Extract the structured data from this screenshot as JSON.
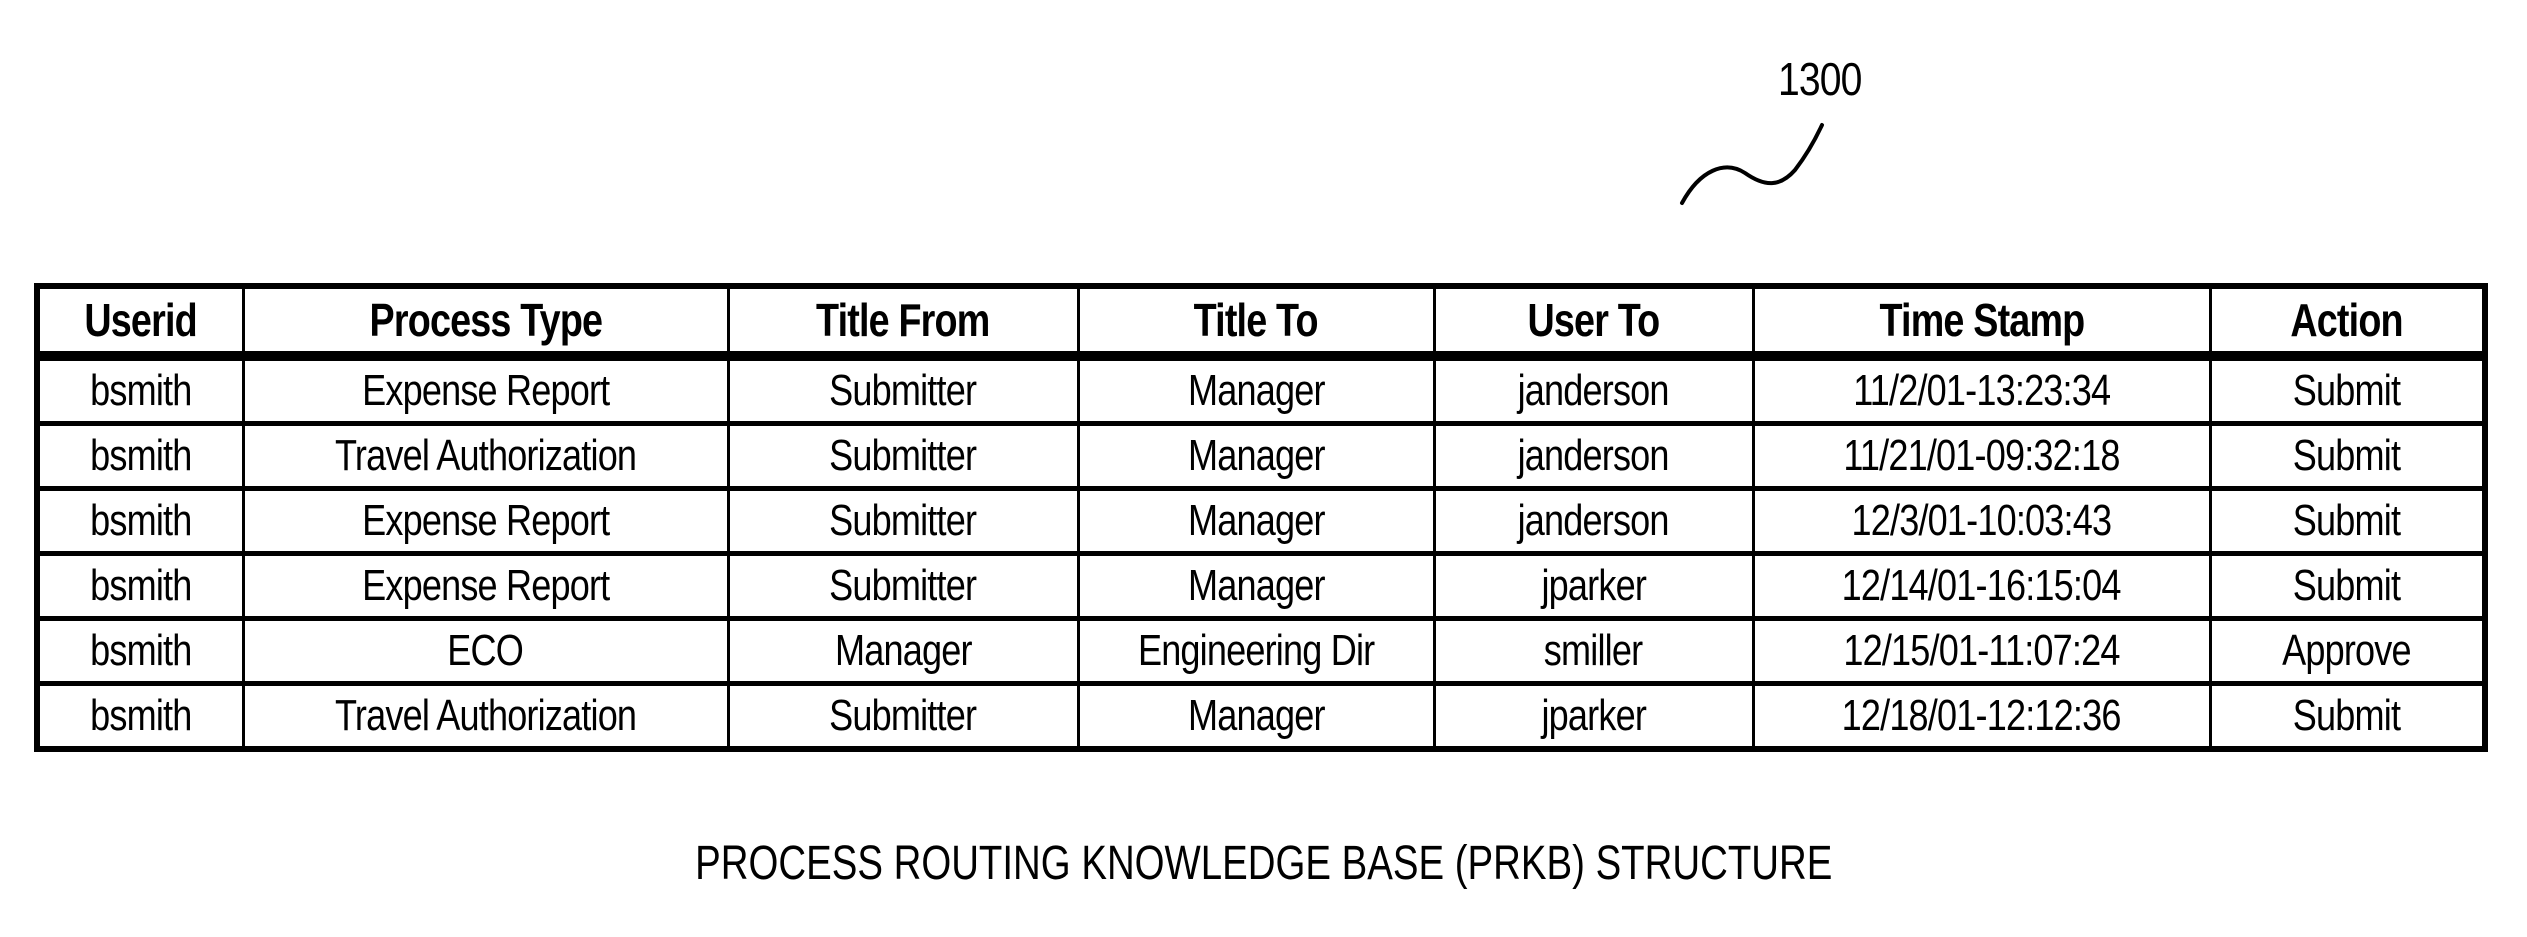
{
  "figure": {
    "reference_numeral": "1300",
    "caption": "PROCESS ROUTING KNOWLEDGE BASE (PRKB) STRUCTURE"
  },
  "table": {
    "columns": [
      "Userid",
      "Process Type",
      "Title From",
      "Title To",
      "User To",
      "Time Stamp",
      "Action"
    ],
    "rows": [
      [
        "bsmith",
        "Expense Report",
        "Submitter",
        "Manager",
        "janderson",
        "11/2/01-13:23:34",
        "Submit"
      ],
      [
        "bsmith",
        "Travel Authorization",
        "Submitter",
        "Manager",
        "janderson",
        "11/21/01-09:32:18",
        "Submit"
      ],
      [
        "bsmith",
        "Expense Report",
        "Submitter",
        "Manager",
        "janderson",
        "12/3/01-10:03:43",
        "Submit"
      ],
      [
        "bsmith",
        "Expense Report",
        "Submitter",
        "Manager",
        "jparker",
        "12/14/01-16:15:04",
        "Submit"
      ],
      [
        "bsmith",
        "ECO",
        "Manager",
        "Engineering Dir",
        "smiller",
        "12/15/01-11:07:24",
        "Approve"
      ],
      [
        "bsmith",
        "Travel Authorization",
        "Submitter",
        "Manager",
        "jparker",
        "12/18/01-12:12:36",
        "Submit"
      ]
    ]
  },
  "icons": {
    "leader_line": "squiggle-leader-icon"
  }
}
